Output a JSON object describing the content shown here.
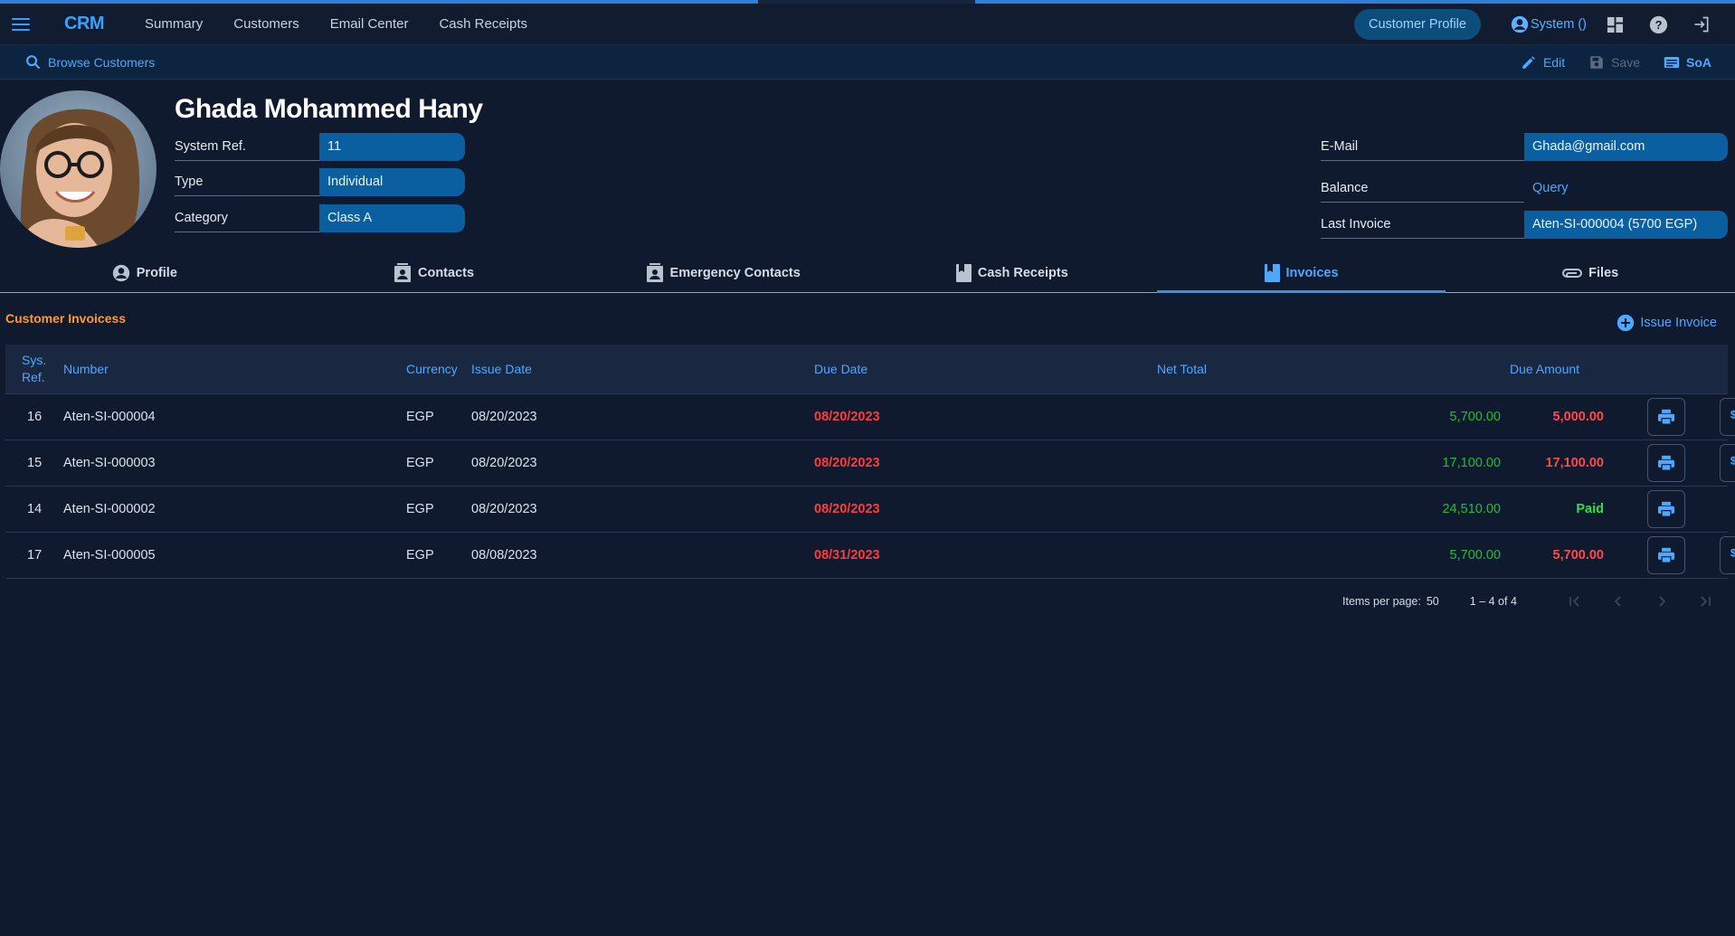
{
  "app": {
    "brand": "CRM",
    "accent": "#3aa0ff"
  },
  "nav": {
    "links": [
      "Summary",
      "Customers",
      "Email Center",
      "Cash Receipts"
    ]
  },
  "topright": {
    "customer_profile": "Customer Profile",
    "user": "System ()",
    "icons": [
      "dashboard-icon",
      "help-icon",
      "logout-icon"
    ]
  },
  "subbar": {
    "browse": "Browse Customers",
    "edit": "Edit",
    "save": "Save",
    "soa": "SoA"
  },
  "customer": {
    "name": "Ghada Mohammed Hany",
    "fields_left": [
      {
        "label": "System Ref.",
        "value": "11"
      },
      {
        "label": "Type",
        "value": "Individual"
      },
      {
        "label": "Category",
        "value": "Class A"
      }
    ],
    "fields_right": [
      {
        "label": "E-Mail",
        "value": "Ghada@gmail.com"
      },
      {
        "label": "Balance",
        "value": "Query"
      },
      {
        "label": "Last Invoice",
        "value": "Aten-SI-000004 (5700 EGP)"
      }
    ]
  },
  "tabs": [
    {
      "label": "Profile",
      "icon": "account-circle-icon"
    },
    {
      "label": "Contacts",
      "icon": "contact-card-icon"
    },
    {
      "label": "Emergency Contacts",
      "icon": "contact-card-icon"
    },
    {
      "label": "Cash Receipts",
      "icon": "bookmark-icon"
    },
    {
      "label": "Invoices",
      "icon": "bookmark-icon",
      "active": true
    },
    {
      "label": "Files",
      "icon": "attachment-icon"
    }
  ],
  "invoices": {
    "title": "Customer Invoicess",
    "issue_button": "Issue Invoice",
    "columns": {
      "sys1": "Sys.",
      "sys2": "Ref.",
      "number": "Number",
      "currency": "Currency",
      "issue_date": "Issue Date",
      "due_date": "Due Date",
      "net_total": "Net Total",
      "due_amount": "Due Amount"
    },
    "rows": [
      {
        "sys": "16",
        "number": "Aten-SI-000004",
        "currency": "EGP",
        "issue_date": "08/20/2023",
        "due_date": "08/20/2023",
        "net_total": "5,700.00",
        "due_amount": "5,000.00",
        "paid": false
      },
      {
        "sys": "15",
        "number": "Aten-SI-000003",
        "currency": "EGP",
        "issue_date": "08/20/2023",
        "due_date": "08/20/2023",
        "net_total": "17,100.00",
        "due_amount": "17,100.00",
        "paid": false
      },
      {
        "sys": "14",
        "number": "Aten-SI-000002",
        "currency": "EGP",
        "issue_date": "08/20/2023",
        "due_date": "08/20/2023",
        "net_total": "24,510.00",
        "due_amount": "Paid",
        "paid": true
      },
      {
        "sys": "17",
        "number": "Aten-SI-000005",
        "currency": "EGP",
        "issue_date": "08/08/2023",
        "due_date": "08/31/2023",
        "net_total": "5,700.00",
        "due_amount": "5,700.00",
        "paid": false
      }
    ]
  },
  "pager": {
    "items_per_page_label": "Items per page:",
    "items_per_page": "50",
    "range": "1 – 4 of 4"
  }
}
